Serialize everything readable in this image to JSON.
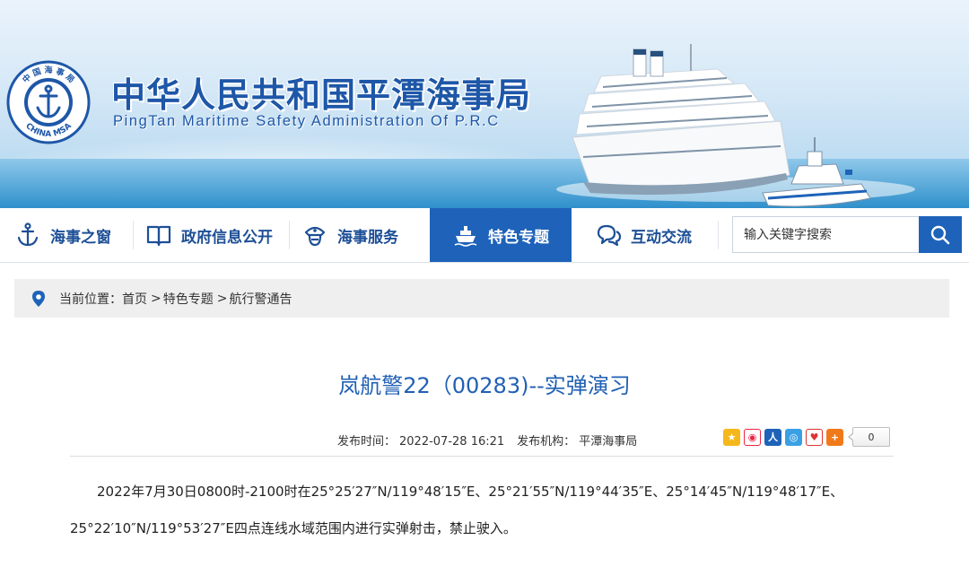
{
  "header": {
    "title": "中华人民共和国平潭海事局",
    "subtitle": "PingTan Maritime Safety Administration Of P.R.C",
    "logo": {
      "top_text": "中 国 海 事 局",
      "bottom_text": "CHINA MSA"
    }
  },
  "nav": {
    "items": [
      {
        "label": "海事之窗",
        "icon": "anchor-icon"
      },
      {
        "label": "政府信息公开",
        "icon": "book-icon"
      },
      {
        "label": "海事服务",
        "icon": "officer-cap-icon"
      },
      {
        "label": "特色专题",
        "icon": "ship-icon",
        "active": true
      },
      {
        "label": "互动交流",
        "icon": "chat-icon"
      }
    ],
    "search": {
      "placeholder": "输入关键字搜索"
    }
  },
  "breadcrumb": {
    "prefix": "当前位置：",
    "items": [
      "首页",
      "特色专题",
      "航行警通告"
    ],
    "separator": ">"
  },
  "article": {
    "title": "岚航警22（00283)--实弹演习",
    "publish_time_label": "发布时间：",
    "publish_time": "2022-07-28 16:21",
    "publisher_label": "发布机构：",
    "publisher": "平潭海事局",
    "share_count": "0",
    "body": "2022年7月30日0800时-2100时在25°25′27″N/119°48′15″E、25°21′55″N/119°44′35″E、25°14′45″N/119°48′17″E、25°22′10″N/119°53′27″E四点连线水域范围内进行实弹射击，禁止驶入。"
  },
  "colors": {
    "brand_blue": "#1e63b9",
    "title_blue": "#2160b4",
    "nav_text": "#1d4f96"
  }
}
